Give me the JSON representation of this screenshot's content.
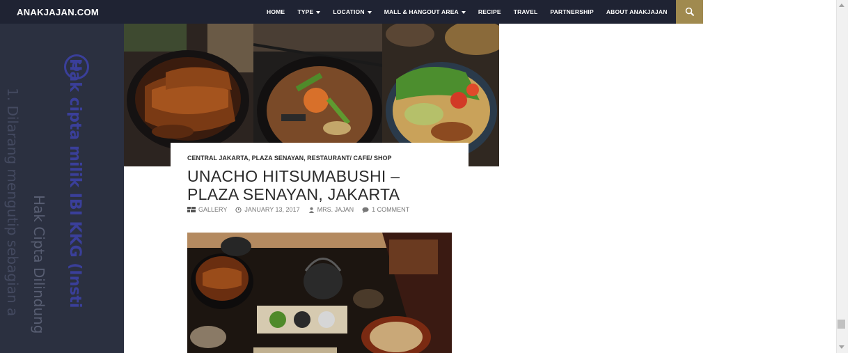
{
  "site": {
    "logo": "ANAKJAJAN.COM"
  },
  "nav": [
    {
      "label": "HOME",
      "dropdown": false
    },
    {
      "label": "TYPE",
      "dropdown": true
    },
    {
      "label": "LOCATION",
      "dropdown": true
    },
    {
      "label": "MALL & HANGOUT AREA",
      "dropdown": true
    },
    {
      "label": "RECIPE",
      "dropdown": false
    },
    {
      "label": "TRAVEL",
      "dropdown": false
    },
    {
      "label": "PARTNERSHIP",
      "dropdown": false
    },
    {
      "label": "ABOUT ANAKJAJAN",
      "dropdown": false
    }
  ],
  "watermark": {
    "symbol": "C",
    "line1": "1. Dilarang mengutip sebagian a",
    "line2": "Hak cipta milik IBI KKG (Insti",
    "line3": "Hak Cipta Dilindung"
  },
  "post": {
    "categories": "CENTRAL JAKARTA, PLAZA SENAYAN, RESTAURANT/ CAFE/ SHOP",
    "title": "UNACHO HITSUMABUSHI – PLAZA SENAYAN, JAKARTA",
    "format": "GALLERY",
    "date": "JANUARY 13, 2017",
    "author": "MRS. JAJAN",
    "comments": "1 COMMENT"
  },
  "colors": {
    "nav_bg": "#1f2333",
    "search_bg": "#a08a4f",
    "sidebar_bg": "#2b3040",
    "watermark_blue": "#3a3f9a"
  }
}
